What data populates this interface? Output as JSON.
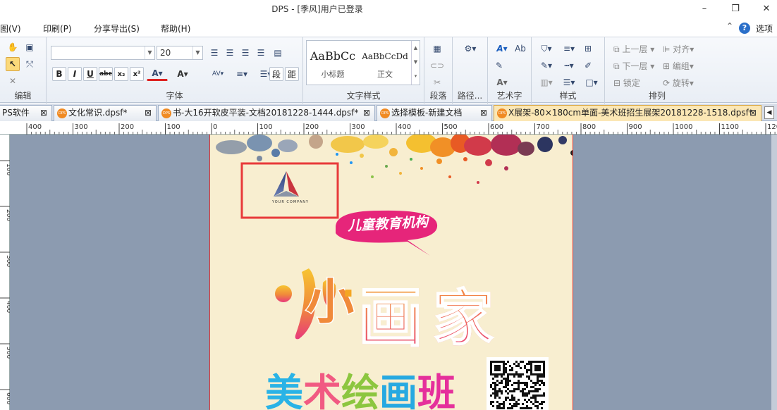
{
  "window": {
    "title": "DPS - [季风]用户已登录"
  },
  "menu": {
    "items": [
      "图(V)",
      "印刷(P)",
      "分享导出(S)",
      "帮助(H)"
    ],
    "options": "选项"
  },
  "ribbon": {
    "groups": [
      "编辑",
      "字体",
      "文字样式",
      "段落",
      "路径...",
      "艺术字",
      "样式",
      "排列"
    ],
    "font_size": "20",
    "font_name": "",
    "styles": [
      {
        "preview": "AaBbCc",
        "name": "小标题"
      },
      {
        "preview": "AaBbCcDd",
        "name": "正文"
      }
    ],
    "arrange": [
      "上一层",
      "对齐",
      "下一层",
      "编组",
      "锁定",
      "旋转"
    ]
  },
  "tabs": [
    {
      "label": "PS软件",
      "icon": "",
      "active": false
    },
    {
      "label": "文化常识.dpsf*",
      "icon": "DPS",
      "active": false
    },
    {
      "label": "书-大16开软皮平装-文档20181228-1444.dpsf*",
      "icon": "DPS",
      "active": false
    },
    {
      "label": "选择模板-新建文档",
      "icon": "DPS",
      "active": false
    },
    {
      "label": "X展架-80×180cm单面-美术班招生展架20181228-1518.dpsf*",
      "icon": "DPS",
      "active": true
    }
  ],
  "ruler": {
    "h_labels": [
      "400",
      "300",
      "200",
      "100",
      "0",
      "100",
      "200",
      "300",
      "400",
      "500",
      "600",
      "700",
      "800",
      "900",
      "1000",
      "1100",
      "1200"
    ],
    "v_labels": [
      "100",
      "200",
      "300",
      "400",
      "500",
      "600"
    ]
  },
  "poster": {
    "company": "YOUR COMPANY",
    "badge": "儿童教育机构",
    "headline": [
      "小",
      "·",
      "画",
      "家"
    ],
    "sub": [
      "美",
      "术",
      "绘",
      "画",
      "班"
    ],
    "colors": {
      "badge": "#e6257a",
      "headline_top": "#f7c531",
      "headline_bottom": "#e8397b",
      "frame": "#e83a3a"
    }
  }
}
